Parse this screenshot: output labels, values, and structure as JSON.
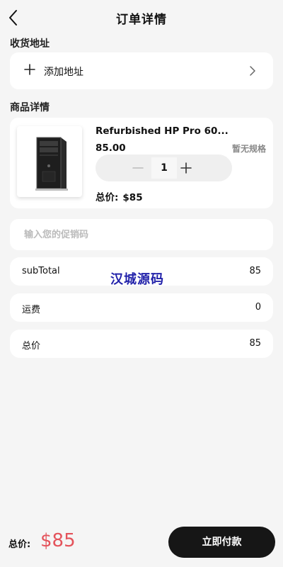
{
  "header": {
    "title": "订单详情"
  },
  "address": {
    "section_label": "收货地址",
    "add_label": "添加地址"
  },
  "product": {
    "section_label": "商品详情",
    "name": "Refurbished HP Pro 60...",
    "price": "85.00",
    "spec": "暂无规格",
    "quantity": "1",
    "total_label": "总价:",
    "total_value": "$85"
  },
  "promo": {
    "placeholder": "输入您的促销码"
  },
  "summary": {
    "subtotal_label": "subTotal",
    "subtotal_value": "85",
    "shipping_label": "运费",
    "shipping_value": "0",
    "total_label": "总价",
    "total_value": "85"
  },
  "watermark": "汉城源码",
  "footer": {
    "total_label": "总价:",
    "total_amount": "$85",
    "pay_label": "立即付款"
  },
  "colors": {
    "accent_price": "#e4535b",
    "pay_button": "#161616",
    "watermark": "#2222aa"
  }
}
